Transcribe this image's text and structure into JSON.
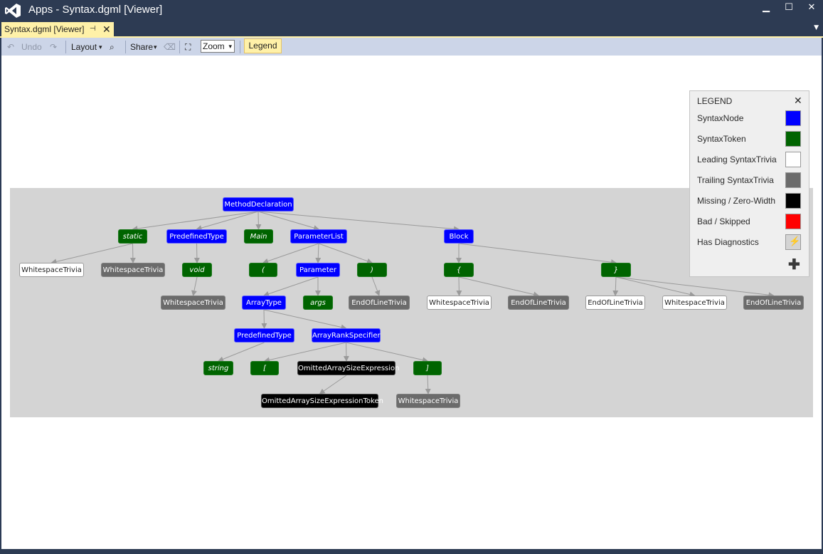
{
  "window": {
    "title": "Apps - Syntax.dgml [Viewer]",
    "minimize_glyph": "▁",
    "maximize_glyph": "☐",
    "close_glyph": "✕",
    "logo_icon": "visual-studio-logo-icon"
  },
  "tab": {
    "label": "Syntax.dgml [Viewer]",
    "pin_glyph": "⊣",
    "close_glyph": "✕",
    "menu_glyph": "▼"
  },
  "toolbar": {
    "undo_label": "Undo",
    "undo_icon_glyph": "↶",
    "redo_icon_glyph": "↷",
    "layout_label": "Layout",
    "dropdown_glyph": "▾",
    "find_icon_glyph": "⌕",
    "share_label": "Share",
    "comment_icon_glyph": "⌫",
    "fit_icon_glyph": "⛶",
    "zoom_value": "Zoom",
    "legend_label": "Legend"
  },
  "colors": {
    "syntax_node": "#0000ff",
    "syntax_token": "#006400",
    "leading_trivia": "#ffffff",
    "trailing_trivia": "#6b6b6b",
    "missing": "#000000",
    "bad_skipped": "#ff0000",
    "diagnostics_bg": "#d4d4d4"
  },
  "graph": {
    "nodes": [
      {
        "id": "method",
        "label": "MethodDeclaration",
        "kind": "syntaxnode"
      },
      {
        "id": "static",
        "label": "static",
        "kind": "token"
      },
      {
        "id": "ptype1",
        "label": "PredefinedType",
        "kind": "syntaxnode"
      },
      {
        "id": "main",
        "label": "Main",
        "kind": "token"
      },
      {
        "id": "plist",
        "label": "ParameterList",
        "kind": "syntaxnode"
      },
      {
        "id": "block",
        "label": "Block",
        "kind": "syntaxnode"
      },
      {
        "id": "ws1",
        "label": "WhitespaceTrivia",
        "kind": "leading"
      },
      {
        "id": "ws2",
        "label": "WhitespaceTrivia",
        "kind": "trailing"
      },
      {
        "id": "void",
        "label": "void",
        "kind": "token"
      },
      {
        "id": "lparen",
        "label": "(",
        "kind": "token"
      },
      {
        "id": "param",
        "label": "Parameter",
        "kind": "syntaxnode"
      },
      {
        "id": "rparen",
        "label": ")",
        "kind": "token"
      },
      {
        "id": "lbrace",
        "label": "{",
        "kind": "token"
      },
      {
        "id": "rbrace",
        "label": "}",
        "kind": "token"
      },
      {
        "id": "ws3",
        "label": "WhitespaceTrivia",
        "kind": "trailing"
      },
      {
        "id": "atype",
        "label": "ArrayType",
        "kind": "syntaxnode"
      },
      {
        "id": "args",
        "label": "args",
        "kind": "token"
      },
      {
        "id": "eol1",
        "label": "EndOfLineTrivia",
        "kind": "trailing"
      },
      {
        "id": "ws4",
        "label": "WhitespaceTrivia",
        "kind": "leading"
      },
      {
        "id": "eol2",
        "label": "EndOfLineTrivia",
        "kind": "trailing"
      },
      {
        "id": "eol3",
        "label": "EndOfLineTrivia",
        "kind": "leading"
      },
      {
        "id": "ws5",
        "label": "WhitespaceTrivia",
        "kind": "leading"
      },
      {
        "id": "eol4",
        "label": "EndOfLineTrivia",
        "kind": "trailing"
      },
      {
        "id": "ptype2",
        "label": "PredefinedType",
        "kind": "syntaxnode"
      },
      {
        "id": "arank",
        "label": "ArrayRankSpecifier",
        "kind": "syntaxnode"
      },
      {
        "id": "string",
        "label": "string",
        "kind": "token"
      },
      {
        "id": "lbrack",
        "label": "[",
        "kind": "token"
      },
      {
        "id": "omitexpr",
        "label": "OmittedArraySizeExpression",
        "kind": "missing"
      },
      {
        "id": "rbrack",
        "label": "]",
        "kind": "token"
      },
      {
        "id": "omittok",
        "label": "OmittedArraySizeExpressionToken",
        "kind": "missing"
      },
      {
        "id": "ws6",
        "label": "WhitespaceTrivia",
        "kind": "trailing"
      }
    ],
    "edges": [
      [
        "method",
        "static"
      ],
      [
        "method",
        "ptype1"
      ],
      [
        "method",
        "main"
      ],
      [
        "method",
        "plist"
      ],
      [
        "method",
        "block"
      ],
      [
        "static",
        "ws1"
      ],
      [
        "static",
        "ws2"
      ],
      [
        "ptype1",
        "void"
      ],
      [
        "void",
        "ws3"
      ],
      [
        "plist",
        "lparen"
      ],
      [
        "plist",
        "param"
      ],
      [
        "plist",
        "rparen"
      ],
      [
        "rparen",
        "eol1"
      ],
      [
        "param",
        "atype"
      ],
      [
        "param",
        "args"
      ],
      [
        "atype",
        "ptype2"
      ],
      [
        "atype",
        "arank"
      ],
      [
        "ptype2",
        "string"
      ],
      [
        "arank",
        "lbrack"
      ],
      [
        "arank",
        "omitexpr"
      ],
      [
        "arank",
        "rbrack"
      ],
      [
        "omitexpr",
        "omittok"
      ],
      [
        "rbrack",
        "ws6"
      ],
      [
        "block",
        "lbrace"
      ],
      [
        "block",
        "rbrace"
      ],
      [
        "lbrace",
        "ws4"
      ],
      [
        "lbrace",
        "eol2"
      ],
      [
        "rbrace",
        "eol3"
      ],
      [
        "rbrace",
        "ws5"
      ],
      [
        "rbrace",
        "eol4"
      ]
    ]
  },
  "legend": {
    "title": "LEGEND",
    "close_glyph": "✕",
    "add_glyph": "✚",
    "items": [
      {
        "label": "SyntaxNode",
        "color": "#0000ff"
      },
      {
        "label": "SyntaxToken",
        "color": "#006400"
      },
      {
        "label": "Leading SyntaxTrivia",
        "color": "#ffffff"
      },
      {
        "label": "Trailing SyntaxTrivia",
        "color": "#6b6b6b"
      },
      {
        "label": "Missing / Zero-Width",
        "color": "#000000"
      },
      {
        "label": "Bad / Skipped",
        "color": "#ff0000"
      },
      {
        "label": "Has Diagnostics",
        "color": "#d4d4d4",
        "icon": "lightning-icon",
        "icon_glyph": "⚡"
      }
    ]
  }
}
